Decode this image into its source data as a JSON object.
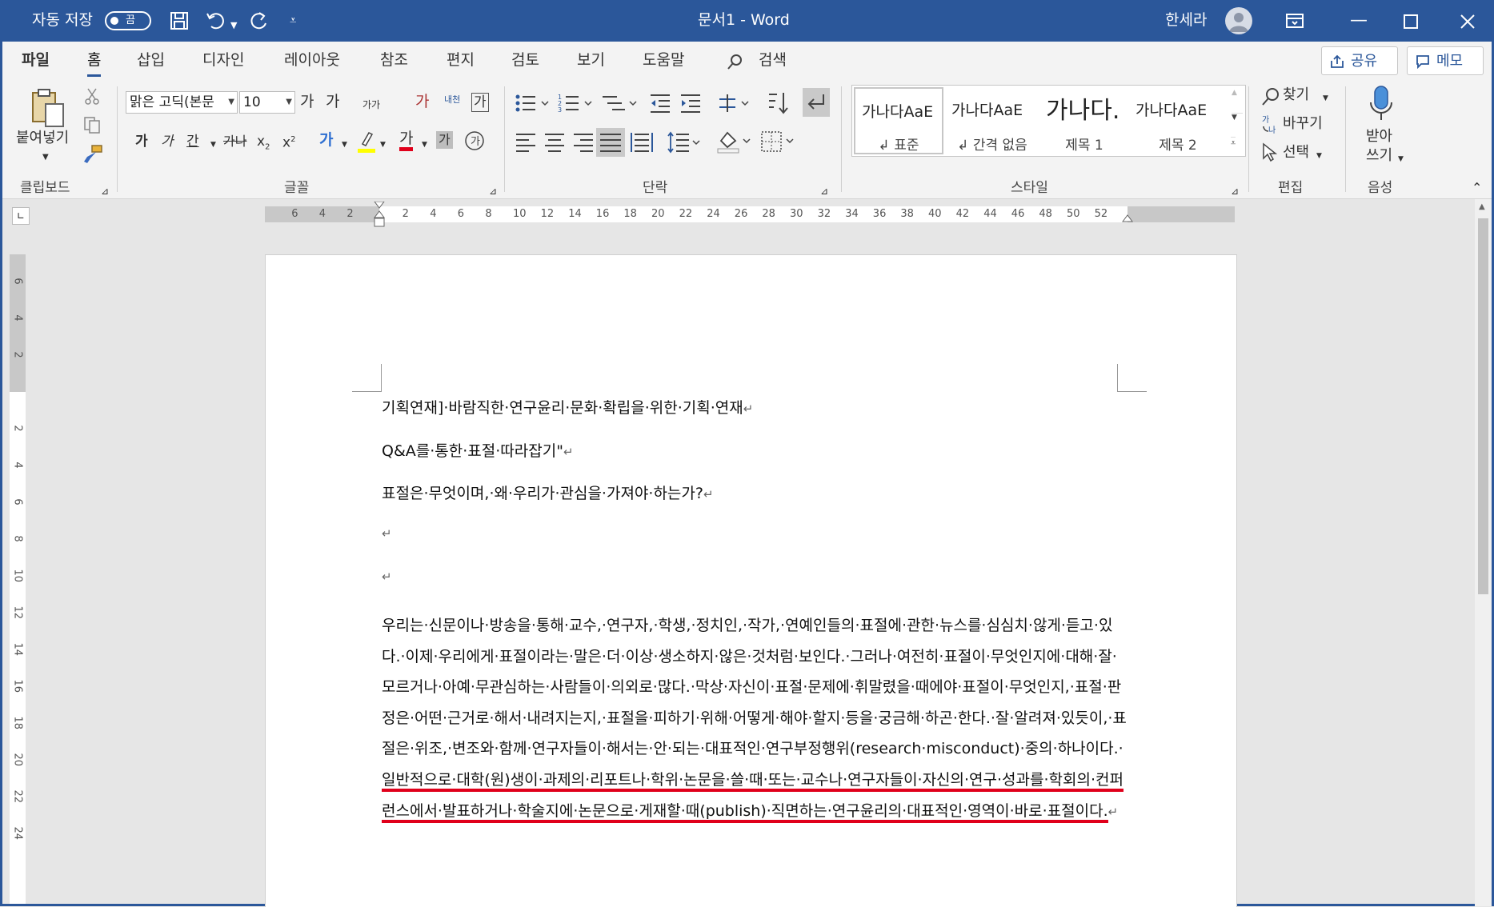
{
  "titlebar": {
    "autosave_label": "자동 저장",
    "autosave_state": "끔",
    "document_title": "문서1  -  Word",
    "user_name": "한세라"
  },
  "tabs": [
    "파일",
    "홈",
    "삽입",
    "디자인",
    "레이아웃",
    "참조",
    "편지",
    "검토",
    "보기",
    "도움말"
  ],
  "active_tab": "홈",
  "search_label": "검색",
  "share_label": "공유",
  "comment_label": "메모",
  "ribbon": {
    "clipboard": {
      "paste_label": "붙여넣기",
      "group_label": "클립보드"
    },
    "font": {
      "font_name": "맑은 고딕(본문",
      "font_size": "10",
      "group_label": "글꼴",
      "bold": "가",
      "italic": "가",
      "underline": "간",
      "strike": "가나",
      "grow": "가",
      "shrink": "가",
      "case": "가가",
      "phonetic": "가",
      "border": "가",
      "font_color": "가",
      "shade": "가",
      "ruby": "내천",
      "highlight_char": "가"
    },
    "paragraph": {
      "group_label": "단락"
    },
    "styles": {
      "group_label": "스타일",
      "items": [
        {
          "sample": "가나다AaE",
          "name": "표준"
        },
        {
          "sample": "가나다AaE",
          "name": "간격 없음"
        },
        {
          "sample": "가나다",
          "name": "제목 1"
        },
        {
          "sample": "가나다AaE",
          "name": "제목 2"
        }
      ]
    },
    "editing": {
      "find": "찾기",
      "replace": "바꾸기",
      "select": "선택",
      "group_label": "편집"
    },
    "voice": {
      "dictate_line1": "받아",
      "dictate_line2": "쓰기",
      "group_label": "음성"
    }
  },
  "ruler": {
    "h_numbers": [
      "6",
      "4",
      "2",
      "2",
      "4",
      "6",
      "8",
      "10",
      "12",
      "14",
      "16",
      "18",
      "20",
      "22",
      "24",
      "26",
      "28",
      "30",
      "32",
      "34",
      "36",
      "38",
      "40",
      "42",
      "44",
      "46",
      "48",
      "50",
      "52"
    ],
    "v_numbers": [
      "6",
      "4",
      "2",
      "2",
      "4",
      "6",
      "8",
      "10",
      "12",
      "14",
      "16",
      "18",
      "20",
      "22",
      "24"
    ]
  },
  "document": {
    "line1": "기획연재]·바람직한·연구윤리·문화·확립을·위한·기획·연재",
    "line2": "Q&A를·통한·표절·따라잡기\"",
    "line3": "표절은·무엇이며,·왜·우리가·관심을·가져야·하는가?",
    "body_plain": "우리는·신문이나·방송을·통해·교수,·연구자,·학생,·정치인,·작가,·연예인들의·표절에·관한·뉴스를·심심치·않게·듣고·있다.·이제·우리에게·표절이라는·말은·더·이상·생소하지·않은·것처럼·보인다.·그러나·여전히·표절이·무엇인지에·대해·잘·모르거나·아예·무관심하는·사람들이·의외로·많다.·막상·자신이·표절·문제에·휘말렸을·때에야·표절이·무엇인지,·표절·판정은·어떤·근거로·해서·내려지는지,·표절을·피하기·위해·어떻게·해야·할지·등을·궁금해·하곤·한다.·잘·알려져·있듯이,·표절은·위조,·변조와·함께·연구자들이·해서는·안·되는·대표적인·연구부정행위(research·misconduct)·중의·하나이다.·",
    "body_underlined": "일반적으로·대학(원)생이·과제의·리포트나·학위·논문을·쓸·때·또는·교수나·연구자들이·자신의·연구·성과를·학회의·컨퍼런스에서·발표하거나·학술지에·논문으로·게재할·때(publish)·직면하는·연구윤리의·대표적인·영역이·바로·표절이다.",
    "para_mark": "↵"
  }
}
